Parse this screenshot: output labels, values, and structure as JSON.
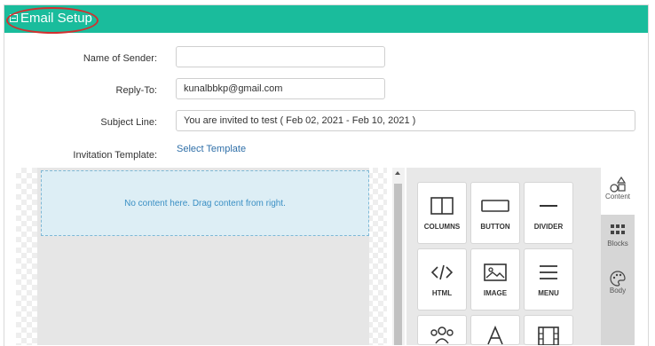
{
  "header": {
    "title": "Email Setup"
  },
  "form": {
    "sender_label": "Name of Sender:",
    "sender_value": "",
    "reply_label": "Reply-To:",
    "reply_value": "kunalbbkp@gmail.com",
    "subject_label": "Subject Line:",
    "subject_value": "You are invited to test ( Feb 02, 2021 - Feb 10, 2021 )",
    "template_label": "Invitation Template:",
    "template_link": "Select Template"
  },
  "editor": {
    "empty_message": "No content here. Drag content from right.",
    "tools": [
      "COLUMNS",
      "BUTTON",
      "DIVIDER",
      "HTML",
      "IMAGE",
      "MENU"
    ],
    "tabs": [
      "Content",
      "Blocks",
      "Body"
    ]
  },
  "colors": {
    "header_bg": "#1abc9c",
    "highlight_circle": "#d32f2f",
    "link": "#2f6fa8"
  }
}
